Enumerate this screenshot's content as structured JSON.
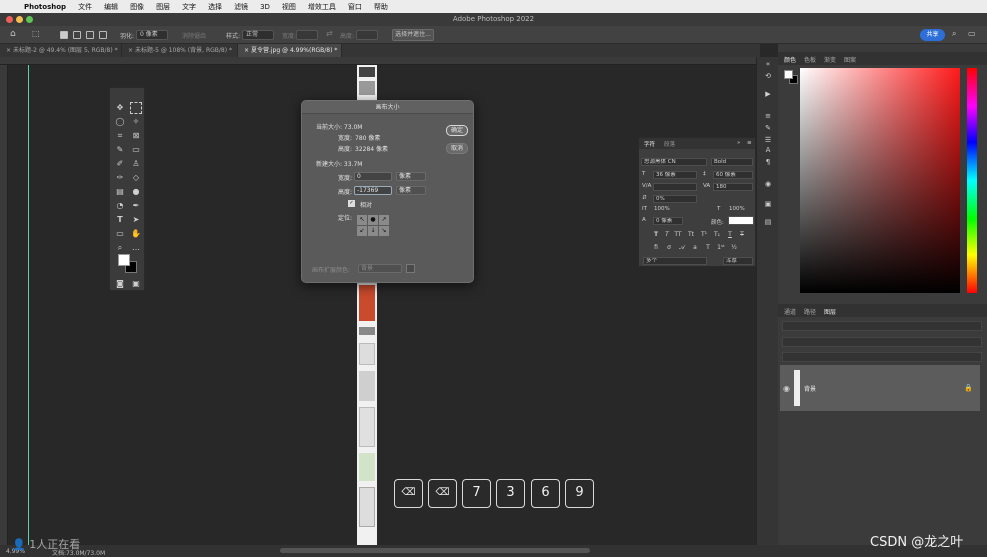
{
  "menubar": {
    "app": "Photoshop",
    "items": [
      "文件",
      "编辑",
      "图像",
      "图层",
      "文字",
      "选择",
      "滤镜",
      "3D",
      "视图",
      "增效工具",
      "窗口",
      "帮助"
    ]
  },
  "window": {
    "title": "Adobe Photoshop 2022"
  },
  "options": {
    "feather_label": "羽化:",
    "feather_value": "0 像素",
    "antialias_label": "消除锯齿",
    "style_label": "样式:",
    "style_value": "正常",
    "width_label": "宽度:",
    "height_label": "高度:",
    "select_mask": "选择并遮住...",
    "share": "共享"
  },
  "tabs": [
    {
      "label": "未标题-2 @ 49.4% (图层 5, RGB/8) *"
    },
    {
      "label": "未标题-5 @ 108% (背景, RGB/8) *"
    },
    {
      "label": "夏令营.jpg @ 4.99%(RGB/8) *",
      "active": true
    }
  ],
  "dialog": {
    "title": "画布大小",
    "current_size_label": "当前大小: 73.0M",
    "cur_width_label": "宽度:",
    "cur_width_value": "780 像素",
    "cur_height_label": "高度:",
    "cur_height_value": "32284 像素",
    "new_size_label": "新建大小: 33.7M",
    "new_width_label": "宽度:",
    "new_width_value": "0",
    "new_width_unit": "像素",
    "new_height_label": "高度:",
    "new_height_value": "-17369",
    "new_height_unit": "像素",
    "relative_label": "相对",
    "anchor_label": "定位:",
    "ext_color_label": "画布扩展颜色:",
    "ext_color_value": "背景",
    "ok": "确定",
    "cancel": "取消"
  },
  "character_panel": {
    "tab_character": "字符",
    "tab_paragraph": "段落",
    "font_family": "思源黑体 CN",
    "font_style": "Bold",
    "font_size": "36 像素",
    "leading": "60 像素",
    "kerning": "",
    "tracking": "180",
    "scale_pct": "0%",
    "vert_scale": "100%",
    "horiz_scale": "100%",
    "baseline": "0 像素",
    "color_label": "颜色:",
    "language": "多个",
    "antialias": "浑厚"
  },
  "right_panel": {
    "color_tabs": [
      "颜色",
      "色板",
      "渐变",
      "图案"
    ],
    "layer_tabs": [
      "通道",
      "路径",
      "图层"
    ],
    "layer_name": "背景"
  },
  "status": {
    "zoom": "4.99%",
    "doc": "文档:73.0M/73.0M"
  },
  "keys": [
    "⌫",
    "⌫",
    "7",
    "3",
    "6",
    "9"
  ],
  "watermark": "1人正在看",
  "credit": "CSDN @龙之叶"
}
